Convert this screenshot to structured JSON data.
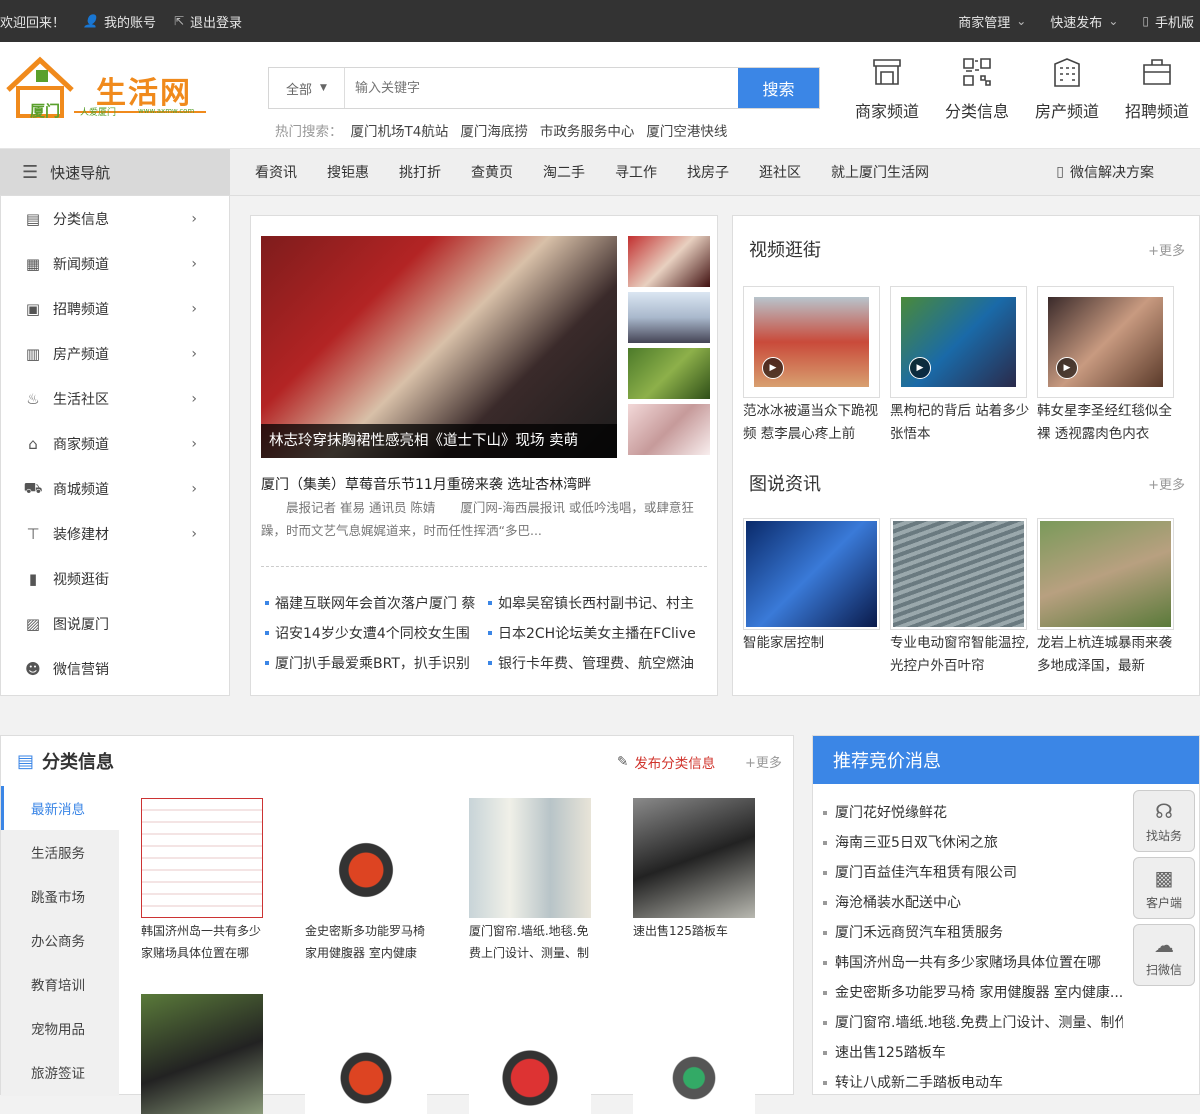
{
  "topbar": {
    "welcome": "欢迎回来！",
    "account": "我的账号",
    "logout": "退出登录",
    "merchant": "商家管理",
    "publish": "快速发布",
    "mobile": "手机版"
  },
  "logo": {
    "main": "生活网",
    "city": "厦门",
    "slogan": "人爱厦门",
    "url": "www.axmw.com"
  },
  "search": {
    "category": "全部",
    "placeholder": "输入关键字",
    "button": "搜索",
    "hot_label": "热门搜索：",
    "hot": [
      "厦门机场T4航站",
      "厦门海底捞",
      "市政务服务中心",
      "厦门空港快线"
    ]
  },
  "channels": [
    "商家频道",
    "分类信息",
    "房产频道",
    "招聘频道"
  ],
  "nav": {
    "quick": "快速导航",
    "links": [
      "看资讯",
      "搜钜惠",
      "挑打折",
      "查黄页",
      "淘二手",
      "寻工作",
      "找房子",
      "逛社区",
      "就上厦门生活网"
    ],
    "wechat": "微信解决方案"
  },
  "sidebar": [
    "分类信息",
    "新闻频道",
    "招聘频道",
    "房产频道",
    "生活社区",
    "商家频道",
    "商城频道",
    "装修建材",
    "视频逛街",
    "图说厦门",
    "微信营销"
  ],
  "news": {
    "caption": "林志玲穿抹胸裙性感亮相《道士下山》现场 卖萌",
    "headline": "厦门（集美）草莓音乐节11月重磅来袭 选址杏林湾畔",
    "desc": "　　晨报记者 崔易 通讯员 陈婧　　厦门网-海西晨报讯 或低吟浅唱，或肆意狂躁，时而文艺气息娓娓道来，时而任性挥洒“多巴...",
    "items": [
      [
        "福建互联网年会首次落户厦门 蔡",
        "如皋吴窑镇长西村副书记、村主"
      ],
      [
        "诏安14岁少女遭4个同校女生围",
        "日本2CH论坛美女主播在FClive"
      ],
      [
        "厦门扒手最爱乘BRT，扒手识别",
        "银行卡年费、管理费、航空燃油"
      ]
    ]
  },
  "video": {
    "title": "视频逛街",
    "more": "+更多",
    "items": [
      "范冰冰被逼当众下跪视频 惹李晨心疼上前",
      "黑枸杞的背后 站着多少张悟本",
      "韩女星李圣经红毯似全裸 透视露肉色内衣"
    ]
  },
  "photo": {
    "title": "图说资讯",
    "more": "+更多",
    "items": [
      "智能家居控制",
      "专业电动窗帘智能温控,光控户外百叶帘",
      "龙岩上杭连城暴雨来袭多地成泽国，最新"
    ]
  },
  "classified": {
    "title": "分类信息",
    "publish": "发布分类信息",
    "more": "+更多",
    "tabs": [
      "最新消息",
      "生活服务",
      "跳蚤市场",
      "办公商务",
      "教育培训",
      "宠物用品",
      "旅游签证"
    ],
    "products": [
      "韩国济州岛一共有多少家赌场具体位置在哪",
      "金史密斯多功能罗马椅 家用健腹器 室内健康",
      "厦门窗帘.墙纸.地毯.免费上门设计、测量、制",
      "速出售125踏板车"
    ]
  },
  "recommend": {
    "title": "推荐竞价消息",
    "items": [
      "厦门花好悦缘鲜花",
      "海南三亚5日双飞休闲之旅",
      "厦门百益佳汽车租赁有限公司",
      "海沧桶装水配送中心",
      "厦门禾远商贸汽车租赁服务",
      "韩国济州岛一共有多少家赌场具体位置在哪",
      "金史密斯多功能罗马椅 家用健腹器 室内健康...",
      "厦门窗帘.墙纸.地毯.免费上门设计、测量、制作...",
      "速出售125踏板车",
      "转让八成新二手踏板电动车"
    ]
  },
  "float": [
    "找站务",
    "客户端",
    "扫微信"
  ],
  "colors": {
    "accent": "#3b86e6",
    "topbar": "#333333",
    "logo_green": "#5aa02c",
    "logo_orange": "#f08a1c",
    "publish_red": "#d0342c"
  }
}
